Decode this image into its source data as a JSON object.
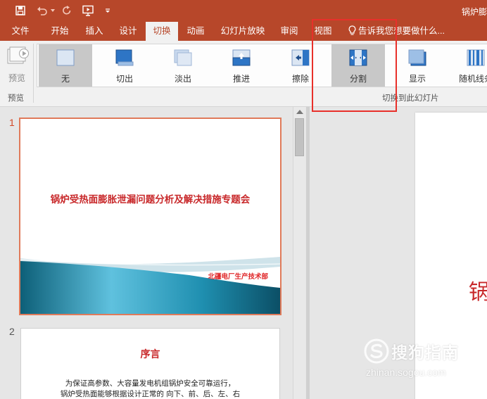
{
  "title_bar": {
    "document_title": "锅炉膨",
    "accent": "#b7472a"
  },
  "quick_access": {
    "items": [
      "save-icon",
      "undo-icon",
      "undo-dropdown-icon",
      "redo-icon",
      "start-slideshow-icon",
      "customize-qat-icon"
    ]
  },
  "menu": {
    "tabs": [
      {
        "label": "文件",
        "active": false
      },
      {
        "label": "开始",
        "active": false
      },
      {
        "label": "插入",
        "active": false
      },
      {
        "label": "设计",
        "active": false
      },
      {
        "label": "切换",
        "active": true
      },
      {
        "label": "动画",
        "active": false
      },
      {
        "label": "幻灯片放映",
        "active": false
      },
      {
        "label": "审阅",
        "active": false
      },
      {
        "label": "视图",
        "active": false
      }
    ],
    "tell_me": "告诉我您想要做什么..."
  },
  "ribbon": {
    "preview_label": "预览",
    "preview_group_label": "预览",
    "transitions": [
      {
        "label": "无",
        "icon": "none-transition-icon",
        "selected": true
      },
      {
        "label": "切出",
        "icon": "cut-transition-icon",
        "selected": false
      },
      {
        "label": "淡出",
        "icon": "fade-transition-icon",
        "selected": false
      },
      {
        "label": "推进",
        "icon": "push-transition-icon",
        "selected": false
      },
      {
        "label": "擦除",
        "icon": "wipe-transition-icon",
        "selected": false
      },
      {
        "label": "分割",
        "icon": "split-transition-icon",
        "selected": true
      },
      {
        "label": "显示",
        "icon": "reveal-transition-icon",
        "selected": false
      },
      {
        "label": "随机线条",
        "icon": "random-bars-transition-icon",
        "selected": false
      }
    ],
    "transitions_group_label": "切换到此幻灯片"
  },
  "slides": {
    "items": [
      {
        "number": "1",
        "title": "锅炉受热面膨胀泄漏问题分析及解决措施专题会",
        "organization": "北疆电厂生产技术部"
      },
      {
        "number": "2",
        "title": "序言",
        "lines": [
          "为保证高参数、大容量发电机组锅炉安全可靠运行，",
          "锅炉受热面能够根据设计正常的 向下、前、后、左、右"
        ]
      }
    ],
    "main_slide_glyph": "锅"
  },
  "watermark": {
    "cn": "搜狗指南",
    "en": "zhinan.sogou.com"
  },
  "colors": {
    "highlight": "#e8302a",
    "slide_title": "#c8282a",
    "ribbon_bg": "#f1f1f1"
  }
}
